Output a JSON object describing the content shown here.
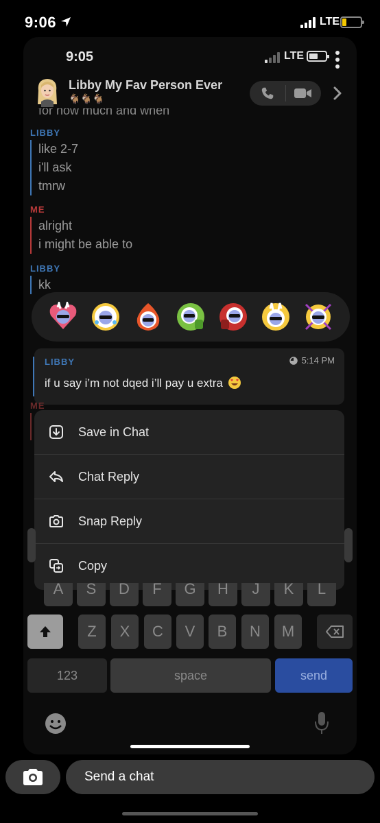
{
  "outer_status": {
    "time": "9:06",
    "network": "LTE"
  },
  "inner_status": {
    "time": "9:05",
    "network": "LTE"
  },
  "chat_header": {
    "name": "Libby My Fav Person Ever",
    "subtitle_icons": "🐐🐐🐐"
  },
  "messages": {
    "cut_line": "for how much and when",
    "groups": [
      {
        "sender": "LIBBY",
        "lines": [
          "like 2-7",
          "i'll ask",
          "tmrw"
        ]
      },
      {
        "sender": "ME",
        "lines": [
          "alright",
          "i might be able to"
        ]
      },
      {
        "sender": "LIBBY",
        "lines": [
          "kk"
        ]
      }
    ],
    "behind_sender": "ME"
  },
  "reactions": [
    "heart-bitmoji-icon",
    "laugh-cry-bitmoji-icon",
    "fire-bitmoji-icon",
    "thumbs-up-bitmoji-icon",
    "thumbs-down-bitmoji-icon",
    "smile-bitmoji-icon",
    "surprised-bitmoji-icon"
  ],
  "selected_message": {
    "sender": "LIBBY",
    "time": "5:14 PM",
    "text": "if u say i’m not dqed i’ll pay u extra"
  },
  "menu": {
    "items": [
      {
        "label": "Save in Chat",
        "icon": "save-icon"
      },
      {
        "label": "Chat Reply",
        "icon": "reply-icon"
      },
      {
        "label": "Snap Reply",
        "icon": "camera-icon"
      },
      {
        "label": "Copy",
        "icon": "copy-icon"
      }
    ]
  },
  "keyboard": {
    "row2_behind": [
      "A",
      "S",
      "D",
      "F",
      "G",
      "H",
      "J",
      "K",
      "L"
    ],
    "row3": [
      "Z",
      "X",
      "C",
      "V",
      "B",
      "N",
      "M"
    ],
    "numbers_label": "123",
    "space_label": "space",
    "send_label": "send"
  },
  "bottom_bar": {
    "placeholder": "Send a chat"
  },
  "colors": {
    "libby": "#3f77b6",
    "me": "#b83a3a",
    "send_key": "#2a4da0"
  }
}
